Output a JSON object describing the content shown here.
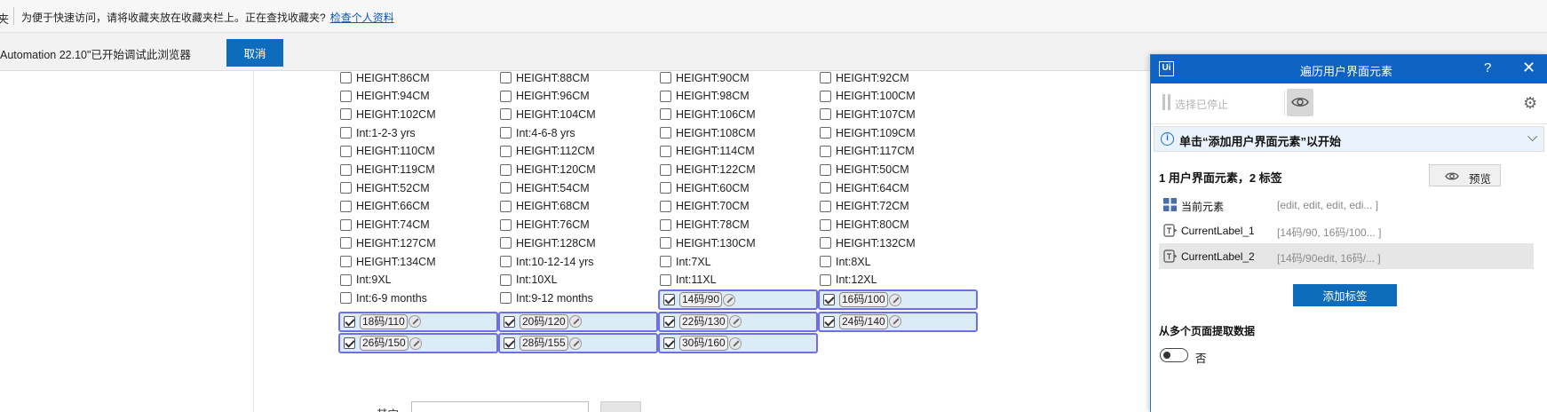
{
  "favorites_bar": {
    "clipped_glyph": "夹",
    "message": "为便于快速访问，请将收藏夹放在收藏夹栏上。正在查找收藏夹?",
    "link": "检查个人资料"
  },
  "debug_bar": {
    "info": "Automation 22.10\"已开始调试此浏览器",
    "cancel": "取消"
  },
  "page": {
    "options": [
      {
        "label": "HEIGHT:86CM",
        "checked": false
      },
      {
        "label": "HEIGHT:88CM",
        "checked": false
      },
      {
        "label": "HEIGHT:90CM",
        "checked": false
      },
      {
        "label": "HEIGHT:92CM",
        "checked": false
      },
      {
        "label": "HEIGHT:94CM",
        "checked": false
      },
      {
        "label": "HEIGHT:96CM",
        "checked": false
      },
      {
        "label": "HEIGHT:98CM",
        "checked": false
      },
      {
        "label": "HEIGHT:100CM",
        "checked": false
      },
      {
        "label": "HEIGHT:102CM",
        "checked": false
      },
      {
        "label": "HEIGHT:104CM",
        "checked": false
      },
      {
        "label": "HEIGHT:106CM",
        "checked": false
      },
      {
        "label": "HEIGHT:107CM",
        "checked": false
      },
      {
        "label": "Int:1-2-3 yrs",
        "checked": false
      },
      {
        "label": "Int:4-6-8 yrs",
        "checked": false
      },
      {
        "label": "HEIGHT:108CM",
        "checked": false
      },
      {
        "label": "HEIGHT:109CM",
        "checked": false
      },
      {
        "label": "HEIGHT:110CM",
        "checked": false
      },
      {
        "label": "HEIGHT:112CM",
        "checked": false
      },
      {
        "label": "HEIGHT:114CM",
        "checked": false
      },
      {
        "label": "HEIGHT:117CM",
        "checked": false
      },
      {
        "label": "HEIGHT:119CM",
        "checked": false
      },
      {
        "label": "HEIGHT:120CM",
        "checked": false
      },
      {
        "label": "HEIGHT:122CM",
        "checked": false
      },
      {
        "label": "HEIGHT:50CM",
        "checked": false
      },
      {
        "label": "HEIGHT:52CM",
        "checked": false
      },
      {
        "label": "HEIGHT:54CM",
        "checked": false
      },
      {
        "label": "HEIGHT:60CM",
        "checked": false
      },
      {
        "label": "HEIGHT:64CM",
        "checked": false
      },
      {
        "label": "HEIGHT:66CM",
        "checked": false
      },
      {
        "label": "HEIGHT:68CM",
        "checked": false
      },
      {
        "label": "HEIGHT:70CM",
        "checked": false
      },
      {
        "label": "HEIGHT:72CM",
        "checked": false
      },
      {
        "label": "HEIGHT:74CM",
        "checked": false
      },
      {
        "label": "HEIGHT:76CM",
        "checked": false
      },
      {
        "label": "HEIGHT:78CM",
        "checked": false
      },
      {
        "label": "HEIGHT:80CM",
        "checked": false
      },
      {
        "label": "HEIGHT:127CM",
        "checked": false
      },
      {
        "label": "HEIGHT:128CM",
        "checked": false
      },
      {
        "label": "HEIGHT:130CM",
        "checked": false
      },
      {
        "label": "HEIGHT:132CM",
        "checked": false
      },
      {
        "label": "HEIGHT:134CM",
        "checked": false
      },
      {
        "label": "Int:10-12-14 yrs",
        "checked": false
      },
      {
        "label": "Int:7XL",
        "checked": false
      },
      {
        "label": "Int:8XL",
        "checked": false
      },
      {
        "label": "Int:9XL",
        "checked": false
      },
      {
        "label": "Int:10XL",
        "checked": false
      },
      {
        "label": "Int:11XL",
        "checked": false
      },
      {
        "label": "Int:12XL",
        "checked": false
      },
      {
        "label": "Int:6-9 months",
        "checked": false
      },
      {
        "label": "Int:9-12 months",
        "checked": false
      },
      {
        "label": "14码/90",
        "checked": true
      },
      {
        "label": "16码/100",
        "checked": true
      },
      {
        "label": "18码/110",
        "checked": true
      },
      {
        "label": "20码/120",
        "checked": true
      },
      {
        "label": "22码/130",
        "checked": true
      },
      {
        "label": "24码/140",
        "checked": true
      },
      {
        "label": "26码/150",
        "checked": true
      },
      {
        "label": "28码/155",
        "checked": true
      },
      {
        "label": "30码/160",
        "checked": true
      }
    ],
    "bottom_label": "其它"
  },
  "panel": {
    "logo": "Ui",
    "title": "遍历用户界面元素",
    "help": "?",
    "close": "✕",
    "stopped": "选择已停止",
    "banner": "单击“添加用户界面元素”以开始",
    "summary": "1 用户界面元素，2 标签",
    "preview": "预览",
    "rows": [
      {
        "name": "当前元素",
        "value": "[edit, edit, edit, edi... ]",
        "icon": "grid-icon"
      },
      {
        "name": "CurrentLabel_1",
        "value": "[14码/90, 16码/100... ]",
        "icon": "label-icon"
      },
      {
        "name": "CurrentLabel_2",
        "value": "[14码/90edit, 16码/... ]",
        "icon": "label-icon"
      }
    ],
    "add_label": "添加标签",
    "multi_page": "从多个页面提取数据",
    "toggle_off": "否",
    "colors": {
      "accent": "#0f6cbd",
      "highlight_border": "#6e6ee8",
      "highlight_fill": "#dcecf6"
    }
  }
}
